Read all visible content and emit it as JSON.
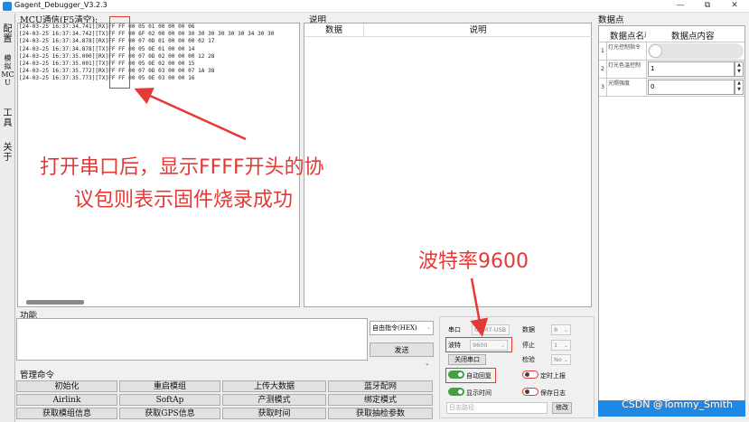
{
  "window": {
    "title": "Gagent_Debugger_V3.2.3",
    "controls": [
      "—",
      "⧉",
      "✕"
    ]
  },
  "side_tabs": [
    "配置",
    "模拟MCU",
    "工具",
    "关于"
  ],
  "mcu_panel": {
    "title": "MCU通信(F5清空):",
    "log_lines": [
      "[24-03-25 16:37:34.741][RX]FF FF 00 05 01 00 00 00 06",
      "[24-03-25 16:37:34.742][TX]FF FF 00 6F 02 00 00 00 30 30 30 30 30 30 34 30 30",
      "[24-03-25 16:37:34.878][RX]FF FF 00 07 0D 01 00 00 00 02 17",
      "[24-03-25 16:37:34.878][TX]FF FF 00 05 0E 01 00 00 14",
      "[24-03-25 16:37:35.000][RX]FF FF 00 07 0D 02 00 00 00 12 28",
      "[24-03-25 16:37:35.001][TX]FF FF 00 05 0E 02 00 00 15",
      "[24-03-25 16:37:35.772][RX]FF FF 00 07 0D 03 00 00 07 1A 38",
      "[24-03-25 16:37:35.773][TX]FF FF 00 05 0E 03 00 00 16"
    ]
  },
  "description_panel": {
    "title": "说明",
    "columns": [
      "数据",
      "说明"
    ]
  },
  "datapoints": {
    "title": "数据点",
    "columns": [
      "数据点名称",
      "数据点内容"
    ],
    "rows": [
      {
        "num": "1",
        "name": "灯光控制指令",
        "value": "",
        "kind": "toggle"
      },
      {
        "num": "2",
        "name": "灯光色温控制",
        "value": "1",
        "kind": "spin"
      },
      {
        "num": "3",
        "name": "光照强度",
        "value": "0",
        "kind": "spin"
      }
    ]
  },
  "function_panel": {
    "title": "功能",
    "custom_cmd": "自由指令(HEX)",
    "send": "发送"
  },
  "commands": {
    "title": "管理命令",
    "buttons": [
      [
        "初始化",
        "重启模组",
        "上传大数据",
        "蓝牙配网"
      ],
      [
        "Airlink",
        "SoftAp",
        "产测模式",
        "绑定模式"
      ],
      [
        "获取模组信息",
        "获取GPS信息",
        "获取时间",
        "获取抽检参数"
      ]
    ]
  },
  "serial": {
    "port_label": "串口",
    "port_value": "COM7-USB",
    "databits_label": "数据",
    "databits_value": "8",
    "baud_label": "波特",
    "baud_value": "9600",
    "stopbits_label": "停止",
    "stopbits_value": "1",
    "parity_label": "检验",
    "parity_value": "No",
    "close_port": "关闭串口",
    "auto_reply": "自动回复",
    "timed_report": "定时上报",
    "show_time": "显示时间",
    "save_log": "保存日志",
    "log_path_placeholder": "日志路径",
    "modify": "修改"
  },
  "annotations": {
    "main_line1": "打开串口后，显示FFFF开头的协",
    "main_line2": "议包则表示固件烧录成功",
    "baud_note": "波特率9600",
    "color": "#e53935"
  },
  "watermark": "CSDN @Tommy_Smith"
}
